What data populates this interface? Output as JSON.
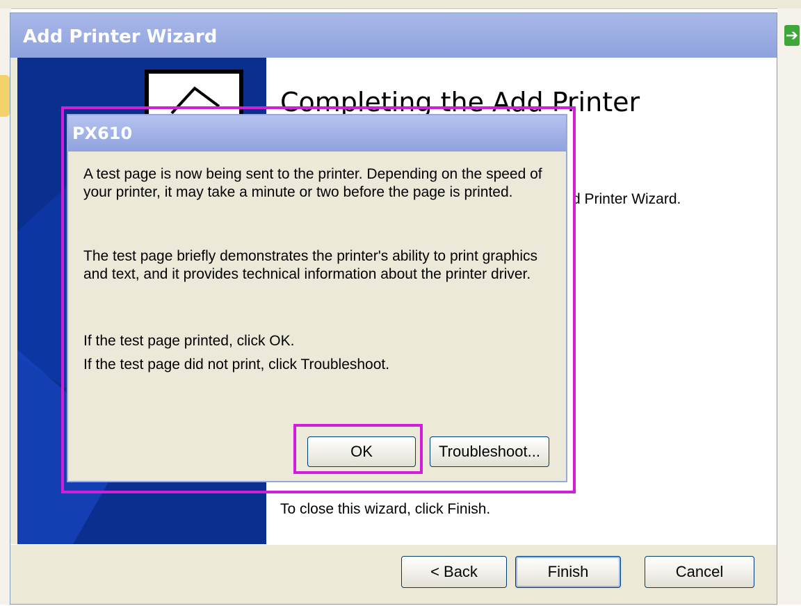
{
  "background": {
    "go_icon": "arrow-right-icon"
  },
  "wizard": {
    "title": "Add Printer Wizard",
    "heading": "Completing the Add Printer",
    "partial_line1": "d Printer Wizard.",
    "partial_line2": ":",
    "close_text": "To close this wizard, click Finish.",
    "buttons": {
      "back": "< Back",
      "finish": "Finish",
      "cancel": "Cancel"
    }
  },
  "dialog": {
    "title": "PX610",
    "para1": "A test page is now being sent to the printer. Depending on the speed of your printer, it may take a minute or two before the page is printed.",
    "para2": "The test page briefly demonstrates the printer's ability to print graphics and text, and it provides technical information about the printer driver.",
    "line_ok": "If the test page printed, click OK.",
    "line_trouble": "If the test page did not print, click Troubleshoot.",
    "buttons": {
      "ok": "OK",
      "troubleshoot": "Troubleshoot..."
    }
  },
  "colors": {
    "highlight": "#d21ed9",
    "title_bar": "#8ea2de",
    "banner": "#0a2f8f"
  }
}
